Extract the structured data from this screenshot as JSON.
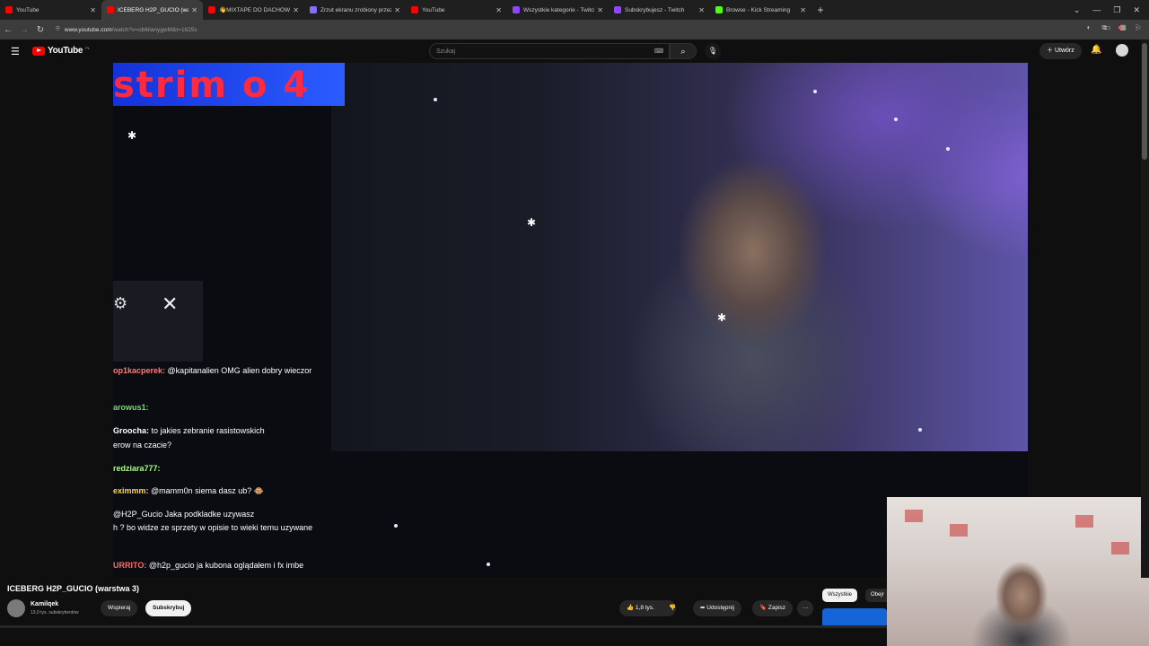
{
  "browser": {
    "tabs": [
      {
        "title": "YouTube",
        "color": "#ff0000",
        "active": false
      },
      {
        "title": "ICEBERG H2P_GUCIO (warstwa 3)",
        "color": "#ff0000",
        "active": true
      },
      {
        "title": "👋MIXTAPE DO DACHOWANIA",
        "color": "#ff0000",
        "active": false
      },
      {
        "title": "Zrzut ekranu zrobiony przez Lig",
        "color": "#8a6cff",
        "active": false
      },
      {
        "title": "YouTube",
        "color": "#ff0000",
        "active": false
      },
      {
        "title": "Wszystkie kategorie - Twitch",
        "color": "#9146ff",
        "active": false
      },
      {
        "title": "Subskrybujesz - Twitch",
        "color": "#9146ff",
        "active": false
      },
      {
        "title": "Browse - Kick Streaming",
        "color": "#53fc18",
        "active": false
      }
    ],
    "tab_display": [
      "YouTube",
      "ICEBERG H2P_GUCIO (wars",
      "👋MIXTAPE DO DACHOWAN",
      "Zrzut ekranu zrobiony przez Lig",
      "YouTube",
      "Wszystkie kategorie - Twitch",
      "Subskrybujesz - Twitch",
      "Browse - Kick Streaming"
    ],
    "url_host": "www.youtube.com",
    "url_path": "/watch?v=ob6ilanygwM&t=1625s"
  },
  "header": {
    "logo": "YouTube",
    "logo_country": "PL",
    "search_placeholder": "Szukaj",
    "create_label": "Utwórz"
  },
  "video": {
    "overlay_text": "strim o 4",
    "chat": [
      {
        "user": "op1kacperek:",
        "text": "@kapitanalien OMG alien dobry wieczor",
        "user_color": "#ff7a7a"
      },
      {
        "user": "arowus1:",
        "text": "",
        "user_color": "#7bd67b"
      },
      {
        "user": "Groocha:",
        "text": "to jakies zebranie rasistowskich",
        "user_color": "#ffffff"
      },
      {
        "user": "",
        "text": "erow na czacie?",
        "user_color": "#ffffff"
      },
      {
        "user": "redziara777:",
        "text": "",
        "user_color": "#a6ff7a"
      },
      {
        "user": "eximmm:",
        "text": "@mamm0n siema dasz ub? 🐵",
        "user_color": "#ffd54a"
      },
      {
        "user": "",
        "text": "@H2P_Gucio Jaka podkladke uzywasz",
        "user_color": "#4a6aff"
      },
      {
        "user": "",
        "text": "h ? bo widze ze sprzety w opisie to wieki temu uzywane",
        "user_color": "#ffffff"
      },
      {
        "user": "URRITO:",
        "text": "@h2p_gucio ja kubona oglądałem i fx imbe",
        "user_color": "#ff6a6a"
      }
    ]
  },
  "info": {
    "title": "ICEBERG H2P_GUCIO (warstwa 3)",
    "channel": "Kamilqek",
    "subscribers": "13,9 tys. subskrybentów",
    "support_label": "Wspieraj",
    "subscribe_label": "Subskrybuj",
    "likes": "1,8 tys.",
    "share_label": "Udostępnij",
    "save_label": "Zapisz",
    "more_label": "···"
  },
  "chips": {
    "all": "Wszystkie",
    "watched": "Obejr"
  }
}
